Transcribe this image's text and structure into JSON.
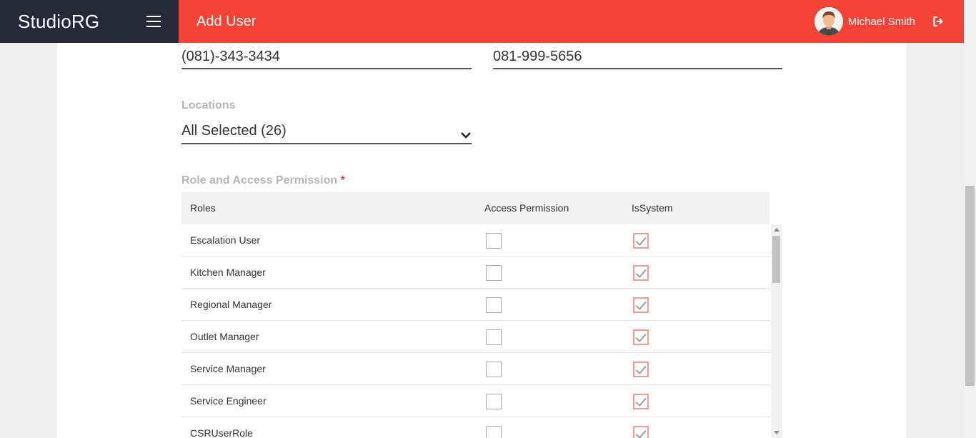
{
  "app": {
    "brand": "StudioRG"
  },
  "header": {
    "title": "Add User",
    "user_name": "Michael Smith"
  },
  "form": {
    "phone_1": "(081)-343-3434",
    "phone_2": "081-999-5656",
    "locations_label": "Locations",
    "locations_value": "All Selected (26)",
    "roles_label": "Role and Access Permission",
    "required_mark": "*"
  },
  "table": {
    "columns": [
      "Roles",
      "Access Permission",
      "IsSystem"
    ],
    "rows": [
      {
        "role": "Escalation User",
        "access": false,
        "is_system": true
      },
      {
        "role": "Kitchen Manager",
        "access": false,
        "is_system": true
      },
      {
        "role": "Regional Manager",
        "access": false,
        "is_system": true
      },
      {
        "role": "Outlet Manager",
        "access": false,
        "is_system": true
      },
      {
        "role": "Service Manager",
        "access": false,
        "is_system": true
      },
      {
        "role": "Service Engineer",
        "access": false,
        "is_system": true
      },
      {
        "role": "CSRUserRole",
        "access": false,
        "is_system": true
      }
    ]
  },
  "colors": {
    "header_red": "#f44336",
    "brand_dark": "#262938"
  },
  "icons": [
    "menu-icon",
    "avatar",
    "logout-icon",
    "chevron-down-icon"
  ]
}
